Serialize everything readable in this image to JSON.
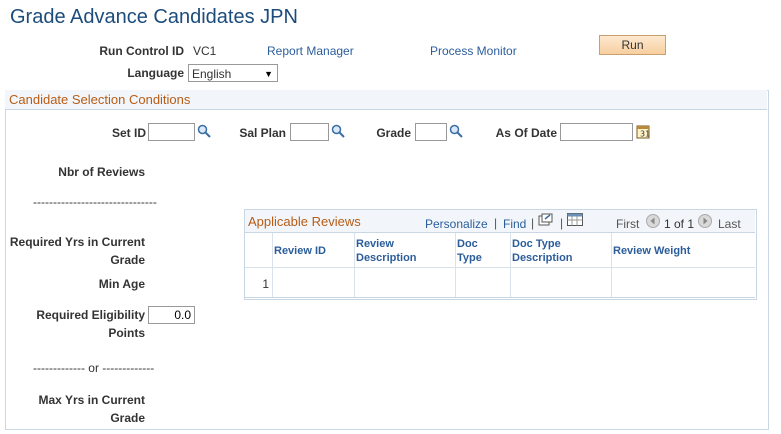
{
  "page": {
    "title": "Grade Advance Candidates JPN"
  },
  "header": {
    "run_control_label": "Run Control ID",
    "run_control_value": "VC1",
    "report_manager": "Report Manager",
    "process_monitor": "Process Monitor",
    "run_label": "Run",
    "language_label": "Language",
    "language_value": "English"
  },
  "conditions": {
    "title": "Candidate Selection Conditions",
    "setid_label": "Set ID",
    "salplan_label": "Sal Plan",
    "grade_label": "Grade",
    "asofdate_label": "As Of Date",
    "nbr_reviews_label": "Nbr of Reviews",
    "divider1": "-------------------------------",
    "req_yrs_label_1": "Required Yrs in Current",
    "req_yrs_label_2": "Grade",
    "min_age_label": "Min Age",
    "req_points_label_1": "Required Eligibility",
    "req_points_label_2": "Points",
    "req_points_value": "0.0",
    "divider2": "------------- or -------------",
    "max_yrs_label_1": "Max Yrs in Current",
    "max_yrs_label_2": "Grade"
  },
  "grid": {
    "title": "Applicable Reviews",
    "personalize": "Personalize",
    "sep": "|",
    "find": "Find",
    "first": "First",
    "range": "1 of 1",
    "last": "Last",
    "columns": [
      [
        "Review ID",
        ""
      ],
      [
        "Review",
        "Description"
      ],
      [
        "Doc",
        "Type"
      ],
      [
        "Doc Type",
        "Description"
      ],
      [
        "Review Weight",
        ""
      ]
    ],
    "rows": [
      {
        "num": "1"
      }
    ]
  }
}
